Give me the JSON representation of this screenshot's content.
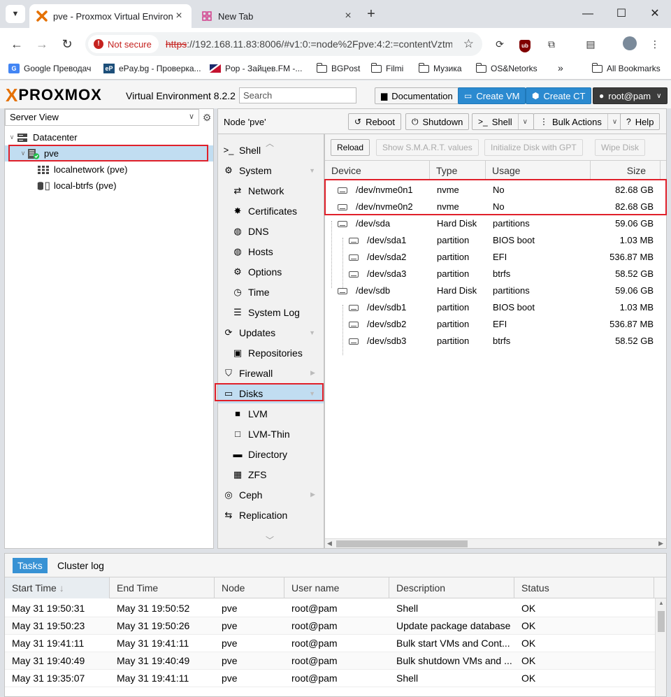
{
  "browser": {
    "active_tab": {
      "title": "pve - Proxmox Virtual Environm"
    },
    "inactive_tab": {
      "title": "New Tab"
    },
    "omnibox": {
      "security_label": "Not secure",
      "url_scheme": "https",
      "url_rest": "://192.168.11.83:8006/#v1:0:=node%2Fpve:4:2:=contentVztm..."
    },
    "bookmarks": [
      {
        "label": "Google Преводач"
      },
      {
        "label": "ePay.bg - Проверка..."
      },
      {
        "label": "Pop - Зайцев.FM -..."
      },
      {
        "label": "BGPost"
      },
      {
        "label": "Filmi"
      },
      {
        "label": "Музика"
      },
      {
        "label": "OS&Netorks"
      }
    ],
    "more_bookmarks": "»",
    "all_bookmarks": "All Bookmarks"
  },
  "pve_header": {
    "logo_x": "X",
    "logo_text": "PROXMOX",
    "version": "Virtual Environment 8.2.2",
    "search_placeholder": "Search",
    "documentation": "Documentation",
    "create_vm": "Create VM",
    "create_ct": "Create CT",
    "user": "root@pam"
  },
  "tree": {
    "view": "Server View",
    "items": [
      {
        "label": "Datacenter"
      },
      {
        "label": "pve"
      },
      {
        "label": "localnetwork (pve)"
      },
      {
        "label": "local-btrfs (pve)"
      }
    ]
  },
  "node_bar": {
    "title": "Node 'pve'",
    "reboot": "Reboot",
    "shutdown": "Shutdown",
    "shell": "Shell",
    "bulk_actions": "Bulk Actions",
    "help": "Help"
  },
  "menu": [
    {
      "label": "Shell",
      "icon": "terminal-icon"
    },
    {
      "label": "System",
      "icon": "gears-icon"
    },
    {
      "label": "Network",
      "icon": "exchange-icon"
    },
    {
      "label": "Certificates",
      "icon": "certificate-icon"
    },
    {
      "label": "DNS",
      "icon": "globe-icon"
    },
    {
      "label": "Hosts",
      "icon": "globe-icon"
    },
    {
      "label": "Options",
      "icon": "gear-icon"
    },
    {
      "label": "Time",
      "icon": "clock-icon"
    },
    {
      "label": "System Log",
      "icon": "list-icon"
    },
    {
      "label": "Updates",
      "icon": "refresh-icon"
    },
    {
      "label": "Repositories",
      "icon": "gift-icon"
    },
    {
      "label": "Firewall",
      "icon": "shield-icon"
    },
    {
      "label": "Disks",
      "icon": "hdd-icon"
    },
    {
      "label": "LVM",
      "icon": "square-icon"
    },
    {
      "label": "LVM-Thin",
      "icon": "square-outline-icon"
    },
    {
      "label": "Directory",
      "icon": "folder-icon"
    },
    {
      "label": "ZFS",
      "icon": "th-large-icon"
    },
    {
      "label": "Ceph",
      "icon": "ceph-icon"
    },
    {
      "label": "Replication",
      "icon": "retweet-icon"
    }
  ],
  "disk_toolbar": {
    "reload": "Reload",
    "smart": "Show S.M.A.R.T. values",
    "init_gpt": "Initialize Disk with GPT",
    "wipe": "Wipe Disk"
  },
  "disk_grid": {
    "columns": [
      "Device",
      "Type",
      "Usage",
      "Size"
    ],
    "rows": [
      {
        "device": "/dev/nvme0n1",
        "type": "nvme",
        "usage": "No",
        "size": "82.68 GB"
      },
      {
        "device": "/dev/nvme0n2",
        "type": "nvme",
        "usage": "No",
        "size": "82.68 GB"
      },
      {
        "device": "/dev/sda",
        "type": "Hard Disk",
        "usage": "partitions",
        "size": "59.06 GB"
      },
      {
        "device": "/dev/sda1",
        "type": "partition",
        "usage": "BIOS boot",
        "size": "1.03 MB"
      },
      {
        "device": "/dev/sda2",
        "type": "partition",
        "usage": "EFI",
        "size": "536.87 MB"
      },
      {
        "device": "/dev/sda3",
        "type": "partition",
        "usage": "btrfs",
        "size": "58.52 GB"
      },
      {
        "device": "/dev/sdb",
        "type": "Hard Disk",
        "usage": "partitions",
        "size": "59.06 GB"
      },
      {
        "device": "/dev/sdb1",
        "type": "partition",
        "usage": "BIOS boot",
        "size": "1.03 MB"
      },
      {
        "device": "/dev/sdb2",
        "type": "partition",
        "usage": "EFI",
        "size": "536.87 MB"
      },
      {
        "device": "/dev/sdb3",
        "type": "partition",
        "usage": "btrfs",
        "size": "58.52 GB"
      }
    ]
  },
  "tasks": {
    "tabs": [
      "Tasks",
      "Cluster log"
    ],
    "columns": [
      "Start Time",
      "End Time",
      "Node",
      "User name",
      "Description",
      "Status"
    ],
    "sort_indicator": "↓",
    "rows": [
      {
        "start": "May 31 19:50:31",
        "end": "May 31 19:50:52",
        "node": "pve",
        "user": "root@pam",
        "desc": "Shell",
        "status": "OK"
      },
      {
        "start": "May 31 19:50:23",
        "end": "May 31 19:50:26",
        "node": "pve",
        "user": "root@pam",
        "desc": "Update package database",
        "status": "OK"
      },
      {
        "start": "May 31 19:41:11",
        "end": "May 31 19:41:11",
        "node": "pve",
        "user": "root@pam",
        "desc": "Bulk start VMs and Cont...",
        "status": "OK"
      },
      {
        "start": "May 31 19:40:49",
        "end": "May 31 19:40:49",
        "node": "pve",
        "user": "root@pam",
        "desc": "Bulk shutdown VMs and ...",
        "status": "OK"
      },
      {
        "start": "May 31 19:35:07",
        "end": "May 31 19:41:11",
        "node": "pve",
        "user": "root@pam",
        "desc": "Shell",
        "status": "OK"
      }
    ]
  },
  "colors": {
    "accent_blue": "#2b8ad0",
    "selection": "#c1ddf1",
    "highlight_red": "#e0202a",
    "proxmox_orange": "#e57000"
  }
}
